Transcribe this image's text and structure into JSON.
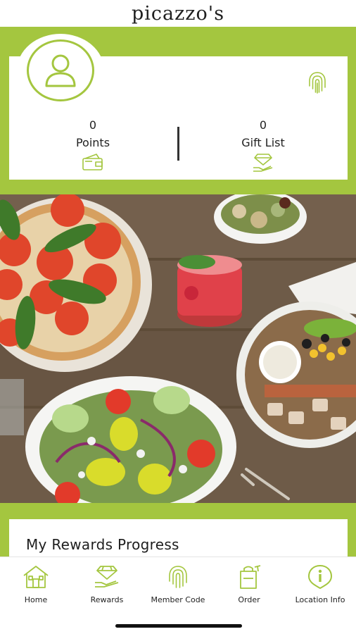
{
  "header": {
    "logo": "picazzo's"
  },
  "profile": {
    "points_value": "0",
    "points_label": "Points",
    "gift_value": "0",
    "gift_label": "Gift List"
  },
  "rewards_section": {
    "title": "My Rewards Progress"
  },
  "tabs": [
    {
      "label": "Home",
      "icon": "house-icon"
    },
    {
      "label": "Rewards",
      "icon": "diamond-hand-icon"
    },
    {
      "label": "Member Code",
      "icon": "fingerprint-icon"
    },
    {
      "label": "Order",
      "icon": "takeout-bag-icon"
    },
    {
      "label": "Location Info",
      "icon": "info-pin-icon"
    }
  ],
  "colors": {
    "brand_green": "#a4c63f",
    "text": "#1a1a1a",
    "background": "#ffffff"
  }
}
